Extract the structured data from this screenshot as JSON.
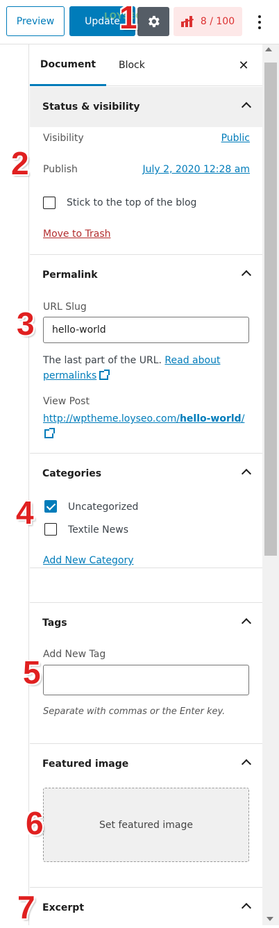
{
  "toolbar": {
    "preview_label": "Preview",
    "update_label": "Update",
    "seo_score": "8 / 100",
    "watermark": "LOYSEO.COM"
  },
  "tabs": {
    "document": "Document",
    "block": "Block"
  },
  "status": {
    "title": "Status & visibility",
    "visibility_label": "Visibility",
    "visibility_value": "Public",
    "publish_label": "Publish",
    "publish_value": "July 2, 2020 12:28 am",
    "sticky_label": "Stick to the top of the blog",
    "trash_label": "Move to Trash"
  },
  "permalink": {
    "title": "Permalink",
    "slug_label": "URL Slug",
    "slug_value": "hello-world",
    "help_text": "The last part of the URL.",
    "help_link_1": "Read about",
    "help_link_2": "permalinks",
    "view_post_label": "View Post",
    "view_post_url_prefix": "http://wptheme.loyseo.com/",
    "view_post_url_slug": "hello-world",
    "view_post_url_suffix": "/"
  },
  "categories": {
    "title": "Categories",
    "items": [
      {
        "label": "Uncategorized",
        "checked": true
      },
      {
        "label": "Textile News",
        "checked": false
      }
    ],
    "add_label": "Add New Category"
  },
  "tags": {
    "title": "Tags",
    "add_label": "Add New Tag",
    "input_value": "",
    "hint": "Separate with commas or the Enter key."
  },
  "featured_image": {
    "title": "Featured image",
    "button_label": "Set featured image"
  },
  "excerpt": {
    "title": "Excerpt"
  },
  "annotations": [
    "1",
    "2",
    "3",
    "4",
    "5",
    "6",
    "7"
  ]
}
